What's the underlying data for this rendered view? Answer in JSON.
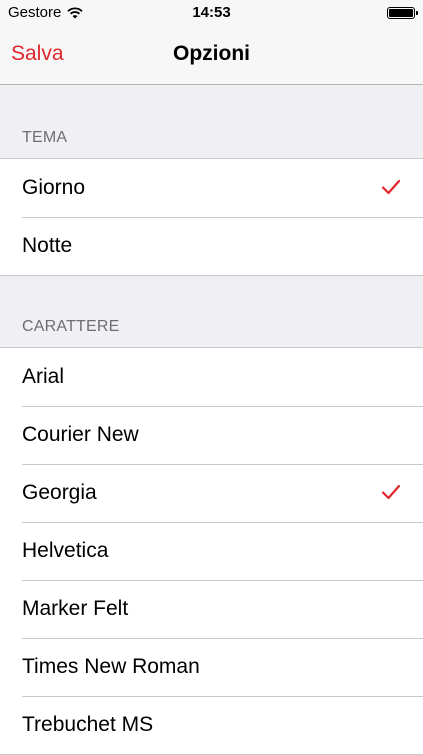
{
  "status": {
    "carrier": "Gestore",
    "time": "14:53"
  },
  "nav": {
    "title": "Opzioni",
    "save_label": "Salva"
  },
  "colors": {
    "accent": "#e1272c",
    "background": "#efeff4"
  },
  "tema": {
    "header": "TEMA",
    "items": [
      {
        "label": "Giorno",
        "selected": true
      },
      {
        "label": "Notte",
        "selected": false
      }
    ]
  },
  "carattere": {
    "header": "CARATTERE",
    "items": [
      {
        "label": "Arial",
        "selected": false
      },
      {
        "label": "Courier New",
        "selected": false
      },
      {
        "label": "Georgia",
        "selected": true
      },
      {
        "label": "Helvetica",
        "selected": false
      },
      {
        "label": "Marker Felt",
        "selected": false
      },
      {
        "label": "Times New Roman",
        "selected": false
      },
      {
        "label": "Trebuchet MS",
        "selected": false
      }
    ]
  }
}
